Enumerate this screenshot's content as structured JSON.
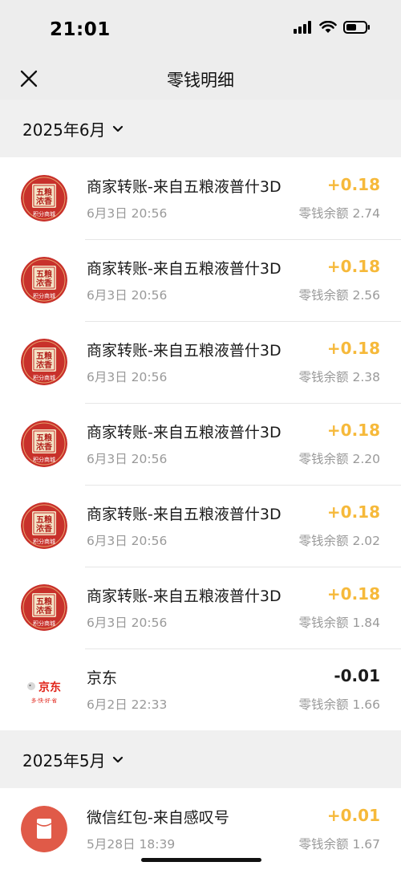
{
  "status_bar": {
    "time": "21:01"
  },
  "nav": {
    "title": "零钱明细"
  },
  "sections": [
    {
      "month": "2025年6月",
      "items": [
        {
          "title": "商家转账-来自五粮液普什3D",
          "time": "6月3日 20:56",
          "amount": "+0.18",
          "balance": "零钱余额 2.74",
          "avatar": "wuliangye-icon"
        },
        {
          "title": "商家转账-来自五粮液普什3D",
          "time": "6月3日 20:56",
          "amount": "+0.18",
          "balance": "零钱余额 2.56",
          "avatar": "wuliangye-icon"
        },
        {
          "title": "商家转账-来自五粮液普什3D",
          "time": "6月3日 20:56",
          "amount": "+0.18",
          "balance": "零钱余额 2.38",
          "avatar": "wuliangye-icon"
        },
        {
          "title": "商家转账-来自五粮液普什3D",
          "time": "6月3日 20:56",
          "amount": "+0.18",
          "balance": "零钱余额 2.20",
          "avatar": "wuliangye-icon"
        },
        {
          "title": "商家转账-来自五粮液普什3D",
          "time": "6月3日 20:56",
          "amount": "+0.18",
          "balance": "零钱余额 2.02",
          "avatar": "wuliangye-icon"
        },
        {
          "title": "商家转账-来自五粮液普什3D",
          "time": "6月3日 20:56",
          "amount": "+0.18",
          "balance": "零钱余额 1.84",
          "avatar": "wuliangye-icon"
        },
        {
          "title": "京东",
          "time": "6月2日 22:33",
          "amount": "-0.01",
          "balance": "零钱余额 1.66",
          "avatar": "jd-icon"
        }
      ]
    },
    {
      "month": "2025年5月",
      "items": [
        {
          "title": "微信红包-来自感叹号",
          "time": "5月28日 18:39",
          "amount": "+0.01",
          "balance": "零钱余额 1.67",
          "avatar": "red-packet-icon"
        }
      ]
    }
  ],
  "avatar_text": {
    "wuliangye_top": "五粮",
    "wuliangye_mid": "浓香",
    "wuliangye_bottom": "积分商城",
    "jd_brand": "京东",
    "jd_slogan": "多·快·好·省"
  },
  "colors": {
    "income": "#f6b93a",
    "expense": "#1b1b1b",
    "background": "#ededed",
    "wuliangye_red": "#c8312b",
    "red_packet": "#e05a48"
  }
}
